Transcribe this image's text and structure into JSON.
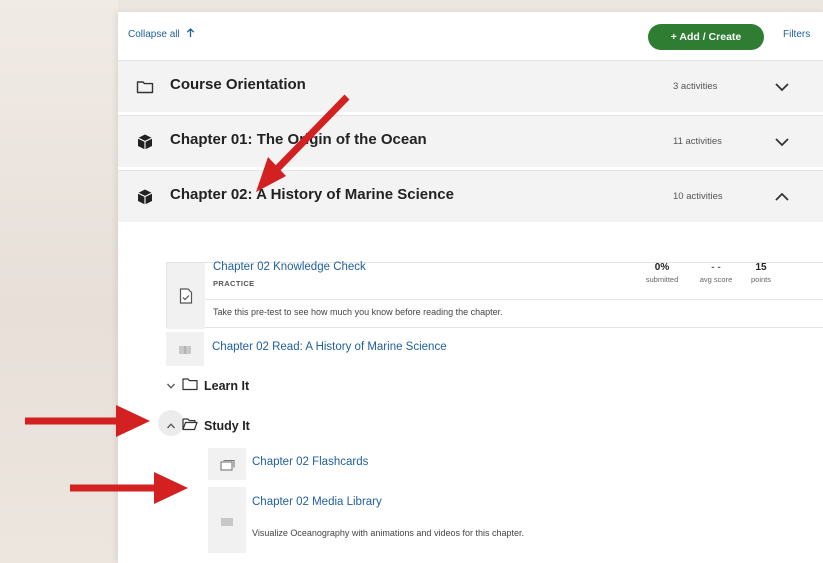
{
  "toolbar": {
    "collapse_all": "Collapse all",
    "add_create": "+ Add / Create",
    "filters": "Filters"
  },
  "sections": [
    {
      "title": "Course Orientation",
      "count": "3 activities",
      "icon": "folder-icon",
      "expanded": false
    },
    {
      "title": "Chapter 01: The Origin of the Ocean",
      "count": "11 activities",
      "icon": "cube-icon",
      "expanded": false
    },
    {
      "title": "Chapter 02: A History of Marine Science",
      "count": "10 activities",
      "icon": "cube-icon",
      "expanded": true
    }
  ],
  "knowledge_check": {
    "title": "Chapter 02 Knowledge Check",
    "type": "PRACTICE",
    "description": "Take this pre-test to see how much you know before reading the chapter.",
    "stats": [
      {
        "value": "0%",
        "label": "submitted"
      },
      {
        "value": "- -",
        "label": "avg score"
      },
      {
        "value": "15",
        "label": "points"
      }
    ]
  },
  "read_item": {
    "title": "Chapter 02 Read: A History of Marine Science"
  },
  "folders": [
    {
      "label": "Learn It",
      "expanded": false
    },
    {
      "label": "Study It",
      "expanded": true
    }
  ],
  "flashcards": {
    "title": "Chapter 02 Flashcards"
  },
  "media_library": {
    "title": "Chapter 02 Media Library",
    "description": "Visualize Oceanography with animations and videos for this chapter."
  },
  "colors": {
    "accent_green": "#2e7d32",
    "link_blue": "#1f5f9c",
    "annotation_red": "#d32020"
  }
}
